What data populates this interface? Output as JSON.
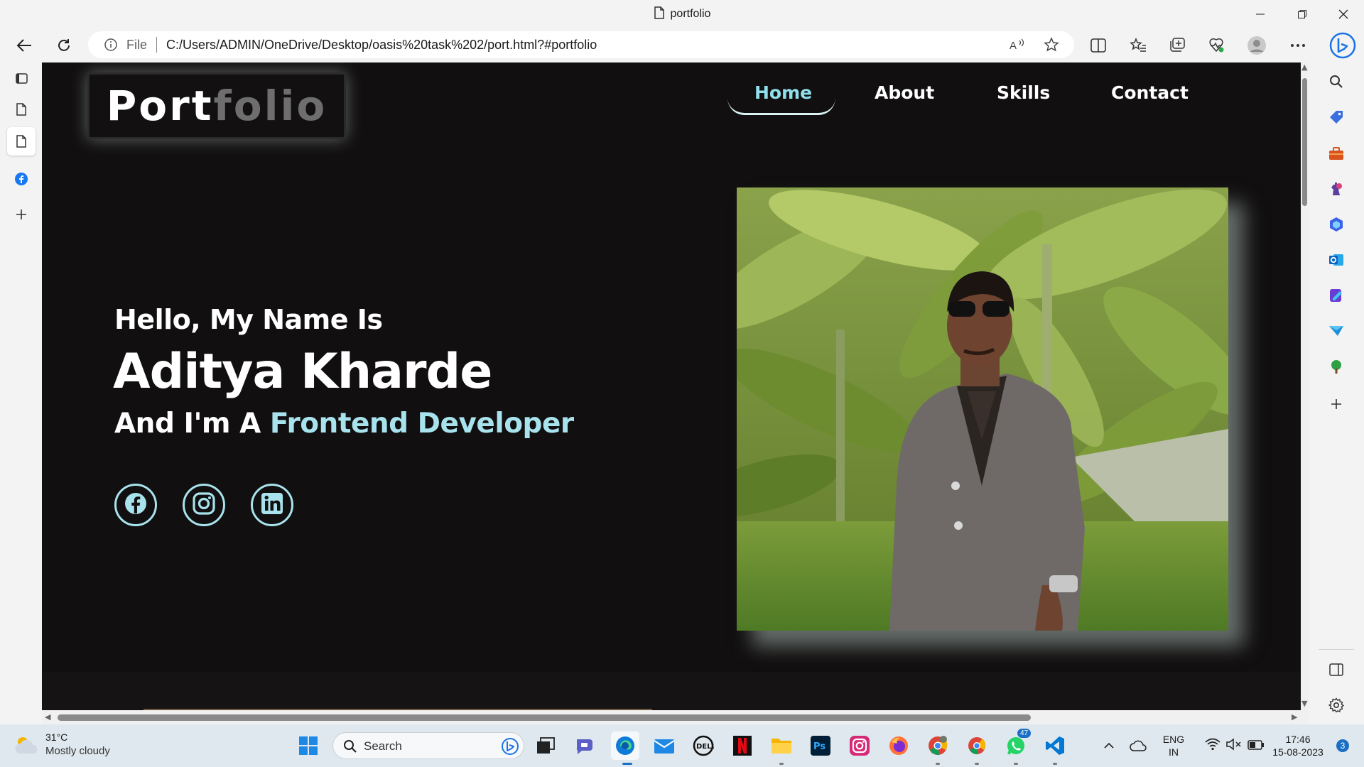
{
  "browser": {
    "tab_title": "portfolio",
    "url_scheme": "File",
    "url": "C:/Users/ADMIN/OneDrive/Desktop/oasis%20task%202/port.html?#portfolio"
  },
  "site": {
    "logo_part1": "Port",
    "logo_part2": "folio",
    "nav": {
      "home": "Home",
      "about": "About",
      "skills": "Skills",
      "contact": "Contact"
    },
    "hero": {
      "greeting": "Hello, My Name Is",
      "name": "Aditya Kharde",
      "role_prefix": "And I'm A",
      "role_accent": "Frontend Developer"
    },
    "social": [
      "facebook-icon",
      "instagram-icon",
      "linkedin-icon"
    ],
    "accent_color": "#a8e2ec",
    "background_color": "#110f0f"
  },
  "taskbar": {
    "weather_temp": "31°C",
    "weather_desc": "Mostly cloudy",
    "search_placeholder": "Search",
    "whatsapp_badge": "47",
    "lang": "ENG",
    "region": "IN",
    "time": "17:46",
    "date": "15-08-2023",
    "notification_count": "3"
  }
}
